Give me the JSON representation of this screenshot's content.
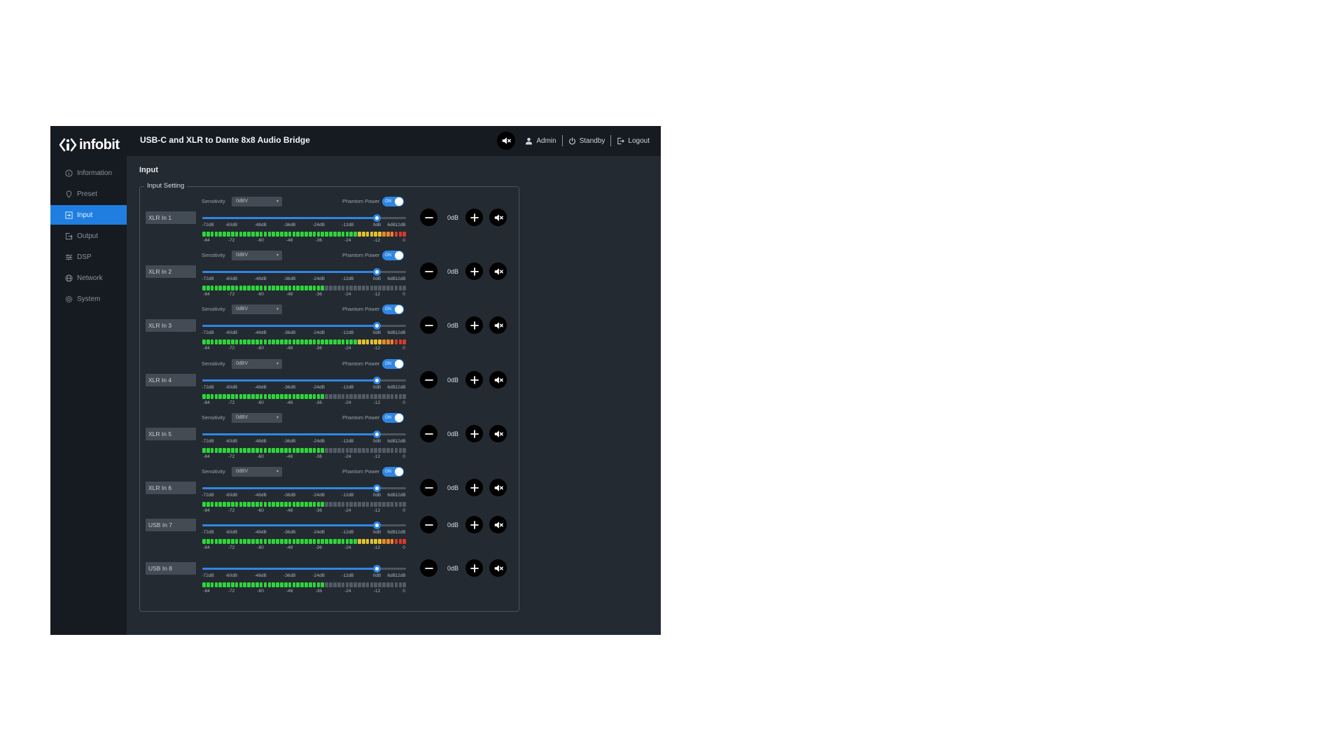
{
  "app": {
    "logo_text": "infobit",
    "title": "USB-C and XLR to Dante 8x8 Audio Bridge"
  },
  "header": {
    "master_mute_icon": "speaker-mute-icon",
    "admin_label": "Admin",
    "standby_label": "Standby",
    "logout_label": "Logout"
  },
  "sidebar": {
    "items": [
      {
        "label": "Information",
        "icon": "info-icon",
        "active": false
      },
      {
        "label": "Preset",
        "icon": "pin-icon",
        "active": false
      },
      {
        "label": "Input",
        "icon": "input-icon",
        "active": true
      },
      {
        "label": "Output",
        "icon": "output-icon",
        "active": false
      },
      {
        "label": "DSP",
        "icon": "sliders-icon",
        "active": false
      },
      {
        "label": "Network",
        "icon": "globe-icon",
        "active": false
      },
      {
        "label": "System",
        "icon": "gear-icon",
        "active": false
      }
    ]
  },
  "main": {
    "heading": "Input",
    "panel_title": "Input Setting",
    "sensitivity_label": "Sensitivity",
    "phantom_label": "Phantom Power",
    "toggle_on_text": "ON",
    "fader_scale": [
      "-72dB",
      "-60dB",
      "-48dB",
      "-36dB",
      "-24dB",
      "-12dB",
      "0dB",
      "6dB",
      "12dB"
    ],
    "meter_scale": [
      "-84",
      "-72",
      "-60",
      "-48",
      "-36",
      "-24",
      "-12",
      "0"
    ],
    "channels": [
      {
        "name": "XLR In 1",
        "sensitivity": "0dBV",
        "phantom": "ON",
        "fader_db": 0,
        "gain": "0dB",
        "meter_level": 1.0
      },
      {
        "name": "XLR In 2",
        "sensitivity": "0dBV",
        "phantom": "ON",
        "fader_db": 0,
        "gain": "0dB",
        "meter_level": 0.6
      },
      {
        "name": "XLR In 3",
        "sensitivity": "0dBV",
        "phantom": "ON",
        "fader_db": 0,
        "gain": "0dB",
        "meter_level": 1.0
      },
      {
        "name": "XLR In 4",
        "sensitivity": "0dBV",
        "phantom": "ON",
        "fader_db": 0,
        "gain": "0dB",
        "meter_level": 0.6
      },
      {
        "name": "XLR In 5",
        "sensitivity": "0dBV",
        "phantom": "ON",
        "fader_db": 0,
        "gain": "0dB",
        "meter_level": 0.6
      },
      {
        "name": "XLR In 6",
        "sensitivity": "0dBV",
        "phantom": "ON",
        "fader_db": 0,
        "gain": "0dB",
        "meter_level": 0.6
      },
      {
        "name": "USB In 7",
        "sensitivity": null,
        "phantom": null,
        "fader_db": 0,
        "gain": "0dB",
        "meter_level": 1.0
      },
      {
        "name": "USB In 8",
        "sensitivity": null,
        "phantom": null,
        "fader_db": 0,
        "gain": "0dB",
        "meter_level": 0.6
      }
    ]
  },
  "colors": {
    "accent": "#2f86e4",
    "meter_green": "#2fd43a",
    "meter_yellow": "#e3c12c",
    "meter_orange": "#e8862b",
    "meter_red": "#d93a2a",
    "meter_off": "#525a65"
  }
}
